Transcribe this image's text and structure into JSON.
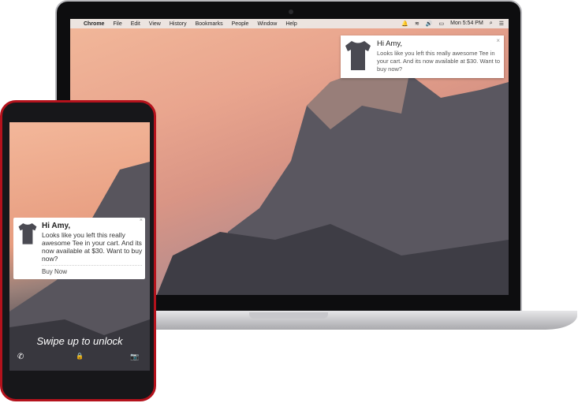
{
  "laptop": {
    "menubar": {
      "apple": "",
      "items": [
        "Chrome",
        "File",
        "Edit",
        "View",
        "History",
        "Bookmarks",
        "People",
        "Window",
        "Help"
      ],
      "status": [
        "🔔",
        "≋",
        "🔊",
        "▭",
        "Mon 5:54 PM",
        "⌕",
        "☰"
      ]
    },
    "notification": {
      "title": "Hi Amy,",
      "body": "Looks like you left this really awesome Tee in your cart. And its now available at $30. Want to buy now?",
      "close": "×"
    }
  },
  "phone": {
    "notification": {
      "title": "Hi Amy,",
      "body": "Looks like you left this really awesome Tee in your cart. And its now available at $30. Want to buy now?",
      "action": "Buy Now",
      "close": "×"
    },
    "lock_text": "Swipe up to unlock",
    "phone_icon": "✆",
    "camera_icon": "📷",
    "lock_icon": "🔒"
  },
  "colors": {
    "phone_frame": "#b4121c"
  }
}
